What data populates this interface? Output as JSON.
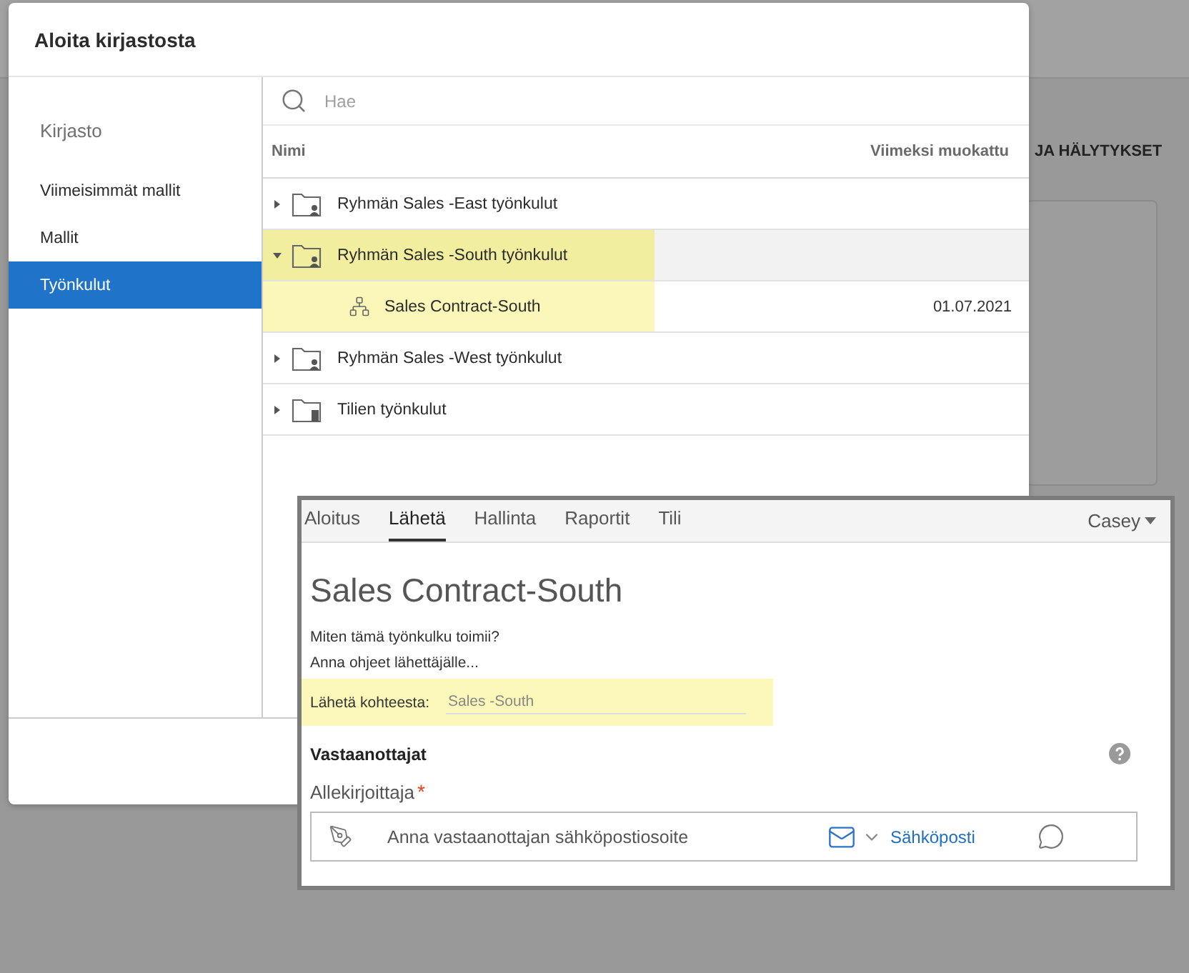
{
  "background": {
    "header_text": "JA HÄLYTYKSET"
  },
  "dialog": {
    "title": "Aloita kirjastosta",
    "sidebar": {
      "heading": "Kirjasto",
      "items": [
        {
          "label": "Viimeisimmät mallit",
          "selected": false
        },
        {
          "label": "Mallit",
          "selected": false
        },
        {
          "label": "Työnkulut",
          "selected": true
        }
      ]
    },
    "search": {
      "placeholder": "Hae"
    },
    "table": {
      "columns": [
        "Nimi",
        "Viimeksi muokattu"
      ],
      "rows": [
        {
          "kind": "group",
          "name": "Ryhmän Sales -East työnkulut",
          "expanded": false,
          "selected": false,
          "highlighted": false
        },
        {
          "kind": "group",
          "name": "Ryhmän Sales -South työnkulut",
          "expanded": true,
          "selected": true,
          "highlighted": true,
          "children": [
            {
              "kind": "workflow",
              "name": "Sales Contract-South",
              "modified": "01.07.2021",
              "selected": false,
              "highlighted": true
            }
          ]
        },
        {
          "kind": "group",
          "name": "Ryhmän Sales -West työnkulut",
          "expanded": false,
          "selected": false,
          "highlighted": false
        },
        {
          "kind": "account",
          "name": "Tilien työnkulut",
          "expanded": false,
          "selected": false,
          "highlighted": false
        }
      ]
    }
  },
  "inset": {
    "tabs": [
      {
        "label": "Aloitus",
        "selected": false
      },
      {
        "label": "Lähetä",
        "selected": true
      },
      {
        "label": "Hallinta",
        "selected": false
      },
      {
        "label": "Raportit",
        "selected": false
      },
      {
        "label": "Tili",
        "selected": false
      }
    ],
    "user": "Casey",
    "title": "Sales Contract-South",
    "description": [
      "Miten tämä työnkulku toimii?",
      "Anna ohjeet lähettäjälle..."
    ],
    "send_from": {
      "label": "Lähetä kohteesta:",
      "value": "Sales -South",
      "highlighted": true
    },
    "section": "Vastaanottajat",
    "recipient": {
      "label": "Allekirjoittaja",
      "required_mark": "*",
      "placeholder": "Anna vastaanottajan sähköpostiosoite",
      "method": "Sähköposti"
    }
  }
}
